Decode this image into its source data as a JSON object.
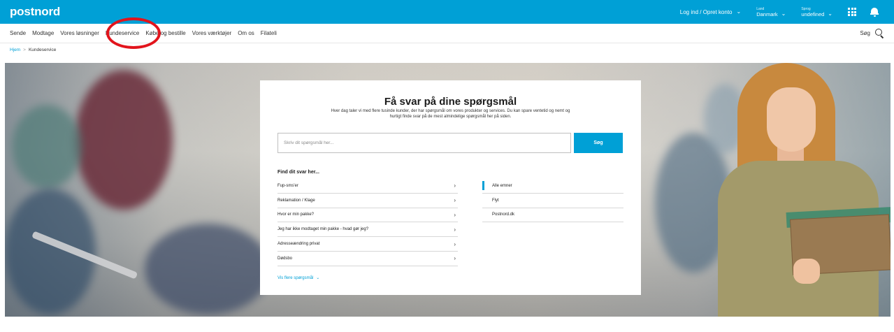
{
  "header": {
    "logo": "postnord",
    "login": "Log ind / Opret konto",
    "country": {
      "label": "Land",
      "value": "Danmark"
    },
    "language": {
      "label": "Sprog",
      "value": "undefined"
    },
    "grid_icon": "apps-grid-icon",
    "bell_icon": "notification-bell-icon",
    "brand_color": "#00a0d6"
  },
  "nav": {
    "items": [
      "Sende",
      "Modtage",
      "Vores løsninger",
      "Kundeservice",
      "Købe og bestille",
      "Vores værktøjer",
      "Om os",
      "Filateli"
    ],
    "highlighted": "Kundeservice",
    "highlight_color": "#e2141c",
    "search_label": "Søg"
  },
  "breadcrumb": {
    "home": "Hjem",
    "sep": ">",
    "current": "Kundeservice"
  },
  "card": {
    "title": "Få svar på dine spørgsmål",
    "description": "Hver dag taler vi med flere tusinde kunder, der har spørgsmål om vores produkter og services. Du kan spare ventetid og nemt og hurtigt finde svar på de mest almindelige spørgsmål her på siden.",
    "search_placeholder": "Skriv dit spørgsmål her...",
    "search_button": "Søg",
    "find_title": "Find dit svar her...",
    "faq": [
      "Fup-sms'er",
      "Reklamation / Klage",
      "Hvor er min pakke?",
      "Jeg har ikke modtaget min pakke - hvad gør jeg?",
      "Adresseændring privat",
      "Dødsbo"
    ],
    "topics": [
      "Alle emner",
      "Flyt",
      "Postnord.dk"
    ],
    "active_topic": "Alle emner",
    "more_link": "Vis flere spørgsmål"
  }
}
